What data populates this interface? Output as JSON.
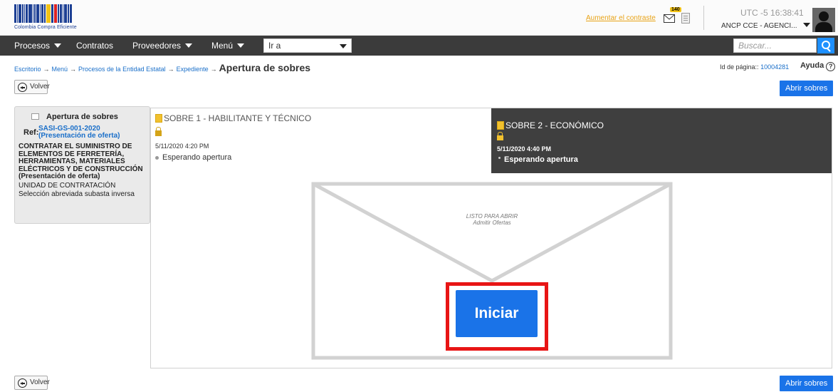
{
  "header": {
    "logo_text": "Colombia Compra Eficiente",
    "contrast_link": "Aumentar el contraste",
    "mail_badge": "140",
    "timezone": "UTC -5",
    "time": "16:38:41",
    "agency": "ANCP CCE - AGENCI..."
  },
  "nav": {
    "items": [
      "Procesos",
      "Contratos",
      "Proveedores",
      "Menú"
    ],
    "goto_value": "Ir a",
    "search_placeholder": "Buscar..."
  },
  "breadcrumb": {
    "items": [
      "Escritorio",
      "Menú",
      "Procesos de la Entidad Estatal",
      "Expediente"
    ],
    "current": "Apertura de sobres",
    "page_id_label": "Id de página::",
    "page_id": "10004281",
    "help": "Ayuda"
  },
  "actions": {
    "back": "Volver",
    "open_envelopes": "Abrir sobres"
  },
  "info": {
    "title": "Apertura de sobres",
    "ref_label": "Ref:",
    "ref_code": "SASI-GS-001-2020",
    "ref_sub": "(Presentación de oferta)",
    "description": "CONTRATAR EL SUMINISTRO DE ELEMENTOS DE FERRETERÍA, HERRAMIENTAS, MATERIALES ELÉCTRICOS Y DE CONSTRUCCIÓN (Presentación de oferta)",
    "unit": "UNIDAD DE CONTRATACIÓN",
    "modality": "Selección abreviada subasta inversa"
  },
  "sobre1": {
    "title": "SOBRE 1 - HABILITANTE Y TÉCNICO",
    "date": "5/11/2020 4:20 PM",
    "status": "Esperando apertura"
  },
  "sobre2": {
    "title": "SOBRE 2 - ECONÓMICO",
    "date": "5/11/2020 4:40 PM",
    "status": "Esperando apertura"
  },
  "envelope": {
    "caption_line1": "LISTO PARA ABRIR",
    "caption_line2": "Admitir Ofertas",
    "start_button": "Iniciar"
  },
  "colors": {
    "primary": "#1a73e8",
    "highlight": "#e81515",
    "navbar": "#3b3b3b"
  }
}
